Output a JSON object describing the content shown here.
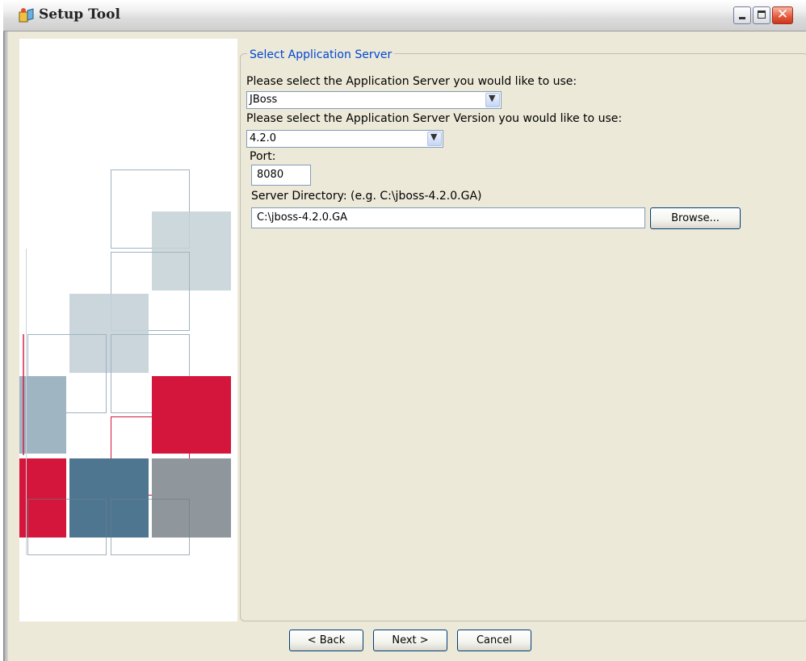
{
  "window": {
    "title": "Setup Tool",
    "icon": "setup-tool-icon",
    "buttons": {
      "minimize": "minimize-icon",
      "maximize": "maximize-icon",
      "close": "close-icon"
    }
  },
  "group": {
    "title": "Select Application Server"
  },
  "server": {
    "label": "Please select the Application Server you would like to use:",
    "value": "JBoss"
  },
  "version": {
    "label": "Please select the Application Server Version you would like to use:",
    "value": "4.2.0"
  },
  "port": {
    "label": "Port:",
    "value": "8080"
  },
  "directory": {
    "label": "Server Directory: (e.g. C:\\jboss-4.2.0.GA)",
    "value": "C:\\jboss-4.2.0.GA",
    "browse_label": "Browse..."
  },
  "nav": {
    "back_label": "< Back",
    "next_label": "Next >",
    "cancel_label": "Cancel"
  },
  "colors": {
    "accent_red": "#d4163c",
    "steel_blue": "#4f7690",
    "slate_gray": "#8f969c",
    "light_blue_gray": "#c4d1d7",
    "legend_blue": "#0046d5"
  }
}
